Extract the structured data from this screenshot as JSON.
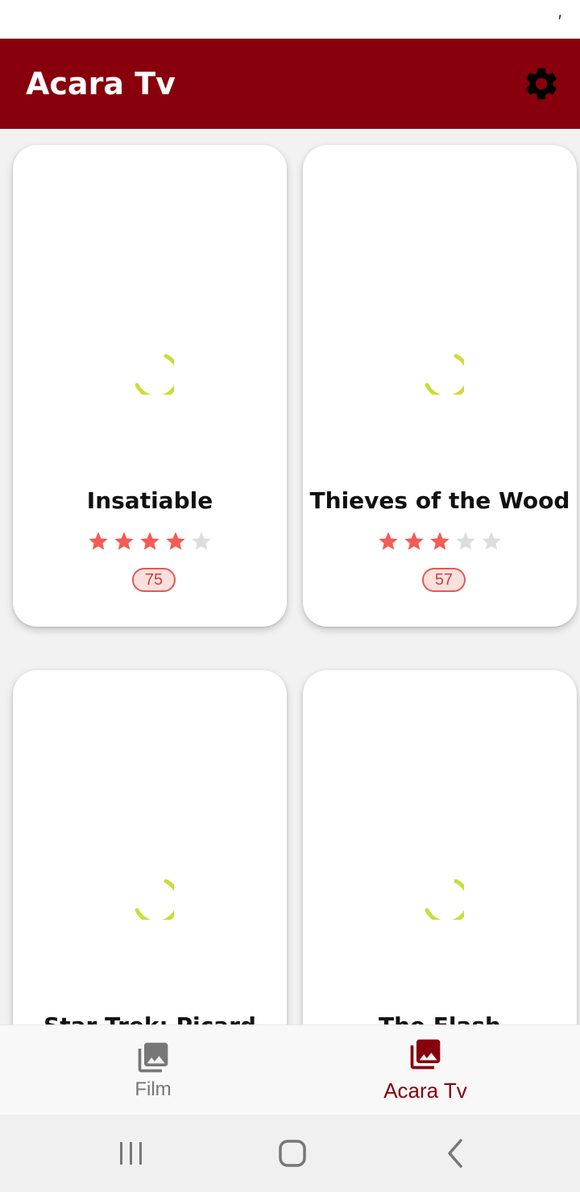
{
  "status_bar": {
    "mark": "′"
  },
  "app_bar": {
    "title": "Acara Tv",
    "settings_icon": "gear-icon"
  },
  "cards": [
    {
      "title": "Insatiable",
      "rating": 4,
      "max_rating": 5,
      "score": "75"
    },
    {
      "title": "Thieves of the Wood",
      "rating": 3,
      "max_rating": 5,
      "score": "57"
    },
    {
      "title": "Star Trek: Picard",
      "rating": 0,
      "max_rating": 5,
      "score": ""
    },
    {
      "title": "The Flash",
      "rating": 0,
      "max_rating": 5,
      "score": ""
    }
  ],
  "bottom_nav": {
    "items": [
      {
        "label": "Film",
        "icon": "photo-library-icon",
        "active": false
      },
      {
        "label": "Acara Tv",
        "icon": "photo-library-icon",
        "active": true
      }
    ]
  },
  "colors": {
    "primary": "#87000b",
    "star_on": "#f25c54",
    "star_off": "#dddddd",
    "spinner": "#cddc39",
    "nav_inactive": "#777777"
  }
}
